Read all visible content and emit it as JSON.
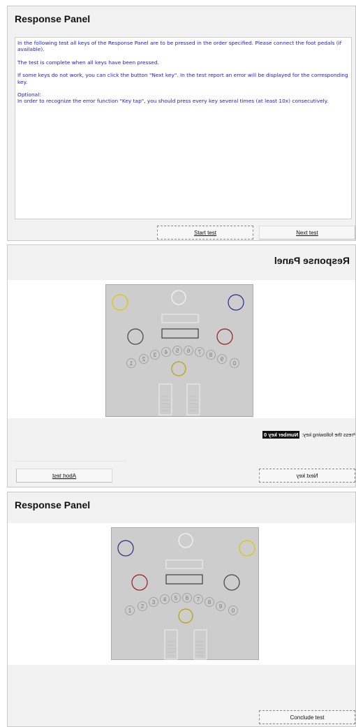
{
  "panel1": {
    "title": "Response Panel",
    "instructions": {
      "p1": "In the following test all keys of the Response Panel are to be pressed in the order specified. Please connect the foot pedals (if available).",
      "p2": "The test is complete when all keys have been pressed.",
      "p3": "If some keys do not work, you can click the button \"Next key\". In the test report an error will be displayed for the corresponding key.",
      "p4_heading": "Optional:",
      "p4": "In order to recognize the error function \"Key tap\", you should press every key several times (at least 10x) consecutively."
    },
    "buttons": {
      "start": "Start test",
      "next": "Next test"
    }
  },
  "panel2": {
    "title": "Response Panel",
    "prompt_label": "Press the following key:",
    "current_key": "Number key 0",
    "buttons": {
      "abort": "Abort test",
      "next_key": "Next key"
    },
    "keypad": {
      "corner_left_color": "#d6c900",
      "corner_right_color": "#2a2a8a",
      "side_left_color": "#444444",
      "side_right_color": "#9a1c1c",
      "center_key_color": "#b8a200",
      "number_keys": [
        "0",
        "9",
        "8",
        "7",
        "6",
        "5",
        "4",
        "3",
        "2",
        "1"
      ]
    }
  },
  "panel3": {
    "title": "Response Panel",
    "buttons": {
      "conclude": "Conclude test"
    },
    "keypad": {
      "corner_left_color": "#2a2a8a",
      "corner_right_color": "#d6c900",
      "side_left_color": "#9a1c1c",
      "side_right_color": "#444444",
      "center_key_color": "#b8a200",
      "number_keys": [
        "1",
        "2",
        "3",
        "4",
        "5",
        "6",
        "7",
        "8",
        "9",
        "0"
      ]
    }
  }
}
